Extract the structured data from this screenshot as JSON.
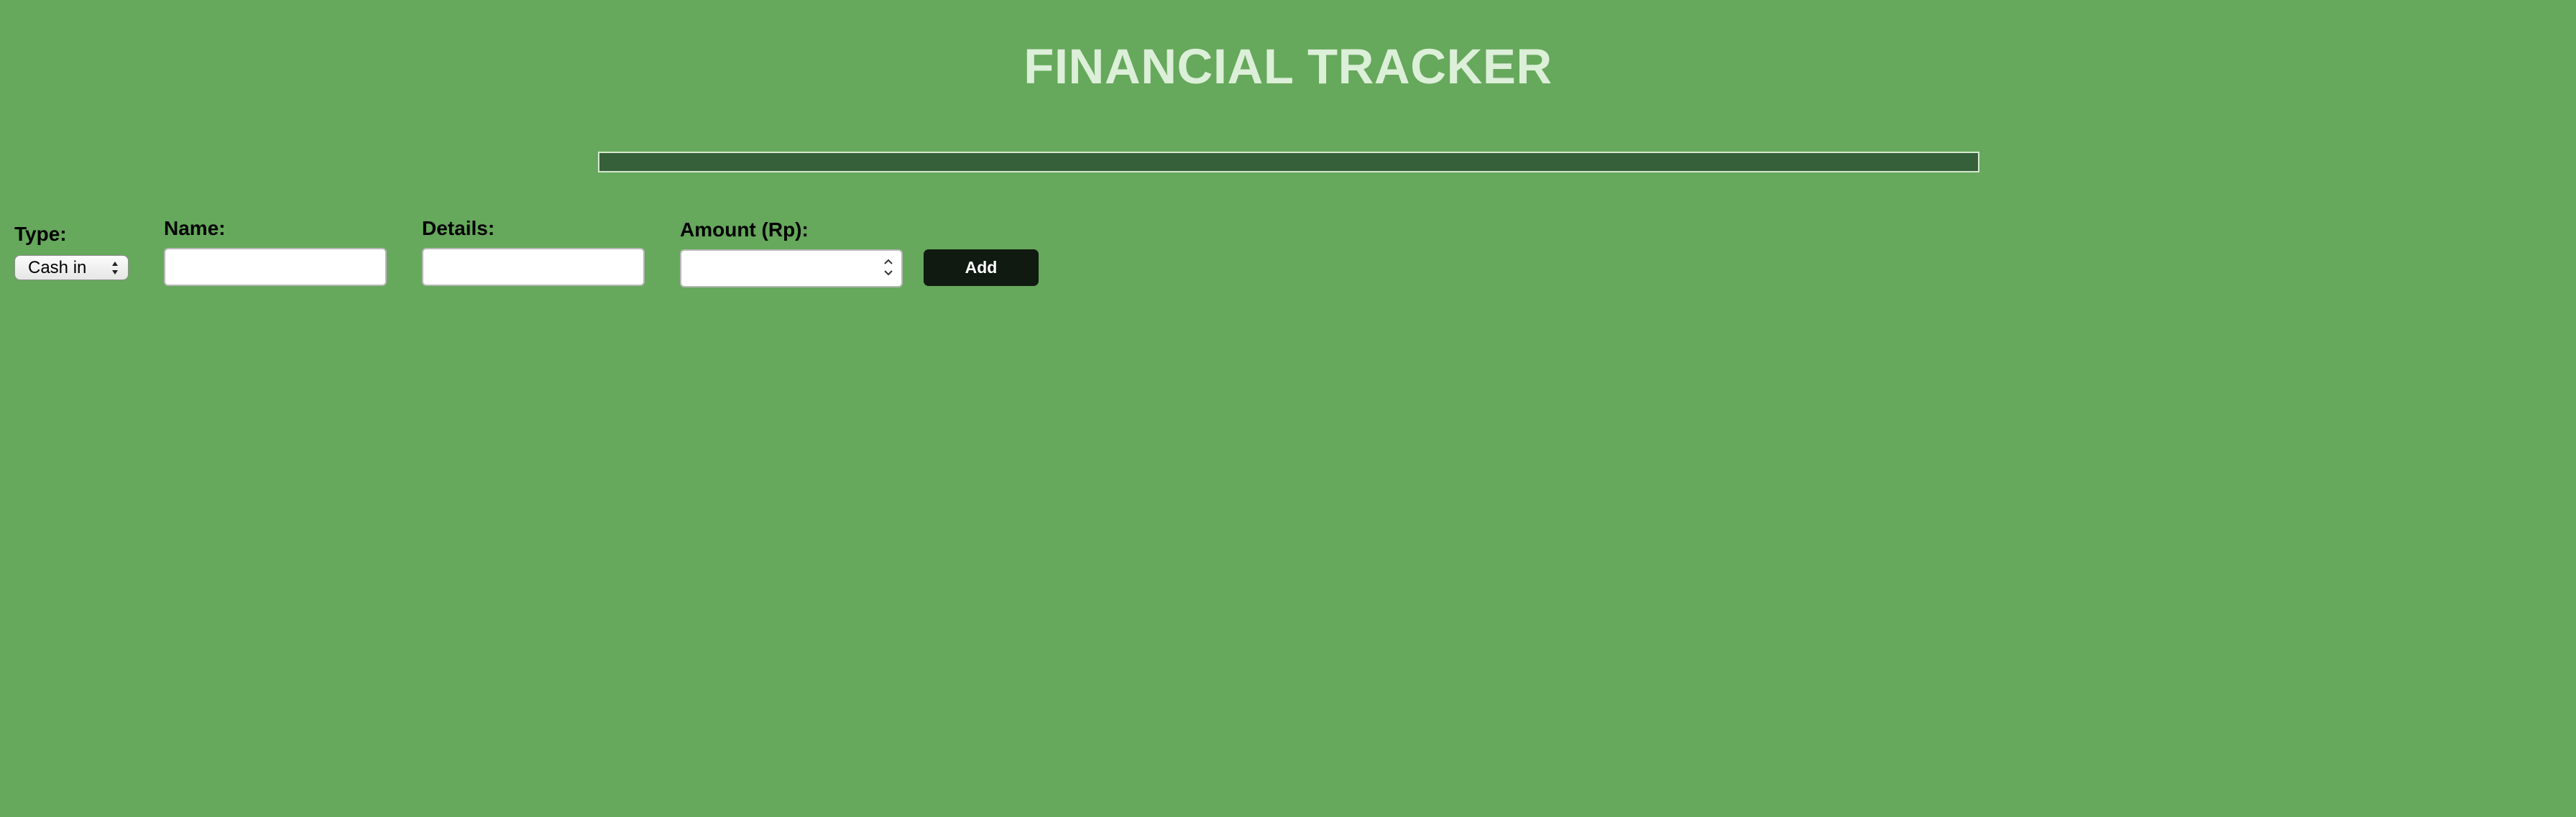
{
  "header": {
    "title": "FINANCIAL TRACKER"
  },
  "progress": {
    "fill_fraction": 0
  },
  "form": {
    "type": {
      "label": "Type:",
      "selected": "Cash in"
    },
    "name": {
      "label": "Name:",
      "value": ""
    },
    "details": {
      "label": "Details:",
      "value": ""
    },
    "amount": {
      "label": "Amount (Rp):",
      "value": ""
    },
    "add_label": "Add"
  },
  "colors": {
    "background": "#66a85c",
    "title": "#dcefd8",
    "bar": "#35603a",
    "button": "#101a10"
  }
}
